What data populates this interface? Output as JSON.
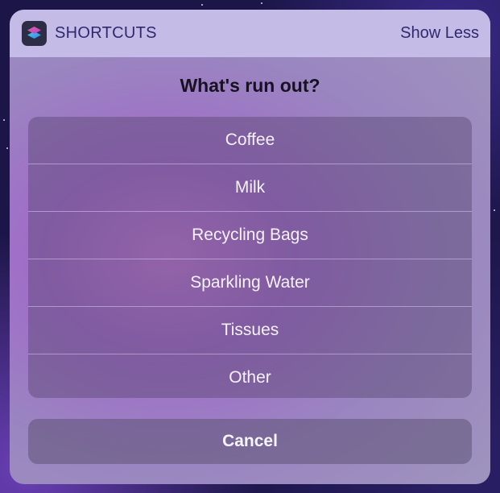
{
  "header": {
    "app_name": "SHORTCUTS",
    "show_less_label": "Show Less",
    "app_icon": "shortcuts-app-icon"
  },
  "prompt": {
    "title": "What's run out?"
  },
  "options": [
    {
      "label": "Coffee"
    },
    {
      "label": "Milk"
    },
    {
      "label": "Recycling Bags"
    },
    {
      "label": "Sparkling Water"
    },
    {
      "label": "Tissues"
    },
    {
      "label": "Other"
    }
  ],
  "cancel": {
    "label": "Cancel"
  },
  "colors": {
    "header_bg": "#c4bbe6",
    "header_text": "#2f2a6e",
    "prompt_text": "#16121f",
    "option_text": "#f4f1fb"
  }
}
